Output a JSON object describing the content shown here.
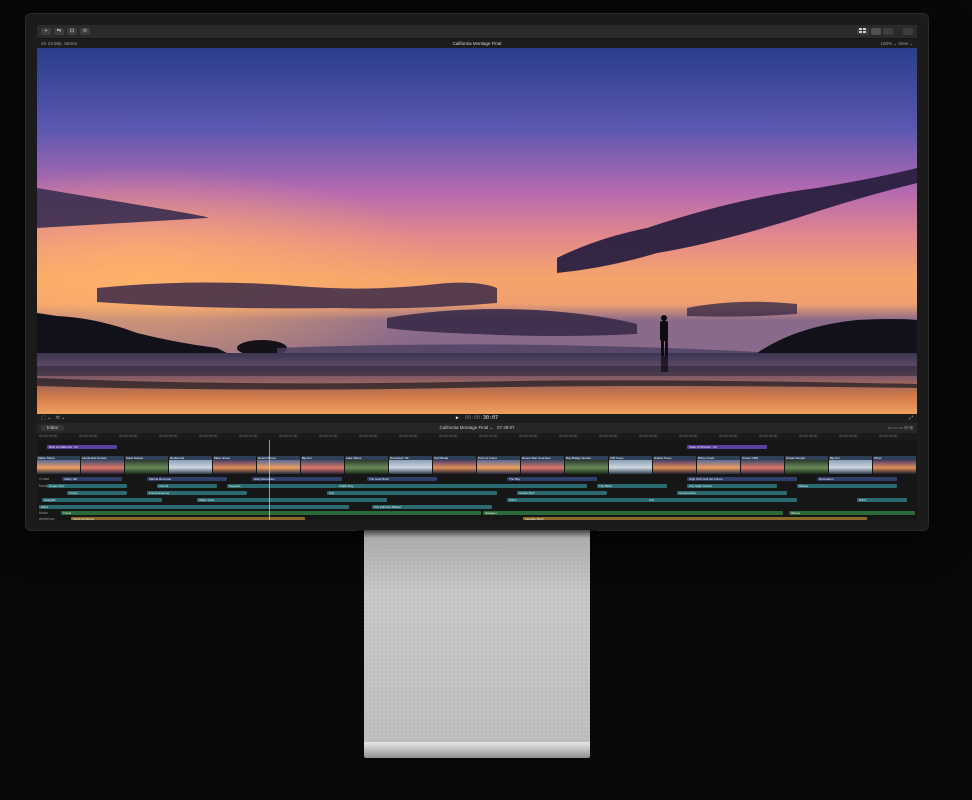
{
  "window": {
    "title": "California Montage Final",
    "toolbar_left": [
      "+",
      "⇆",
      "⊡",
      "⊙"
    ],
    "toolbar_right_icons": [
      "grid-icon",
      "list-icon",
      "inspector-icon",
      "share-icon"
    ]
  },
  "viewer": {
    "format": "4K 23.98p, Stereo",
    "zoom": "100%",
    "view_menu": "View",
    "timecode": "30:07"
  },
  "timeline": {
    "index_label": "Index",
    "project": "California Montage Final",
    "duration": "07:48:07",
    "ruler": [
      "00:00:00:00",
      "00:00:02:00",
      "00:00:04:00",
      "00:00:06:00",
      "00:00:08:00",
      "00:00:10:00",
      "00:00:12:00",
      "00:00:14:00",
      "00:00:16:00",
      "00:00:18:00",
      "00:00:20:00",
      "00:00:22:00",
      "00:00:24:00",
      "00:00:26:00",
      "00:00:28:00",
      "00:00:30:00",
      "00:00:32:00",
      "00:00:34:00",
      "00:00:36:00",
      "00:00:38:00",
      "00:00:40:00",
      "00:00:42:00"
    ],
    "title_clips": [
      {
        "label": "Best of California - 02"
      },
      {
        "label": "State of Wonder - 03"
      }
    ],
    "video_clips": [
      "Valley Shore",
      "Lands End Sunset",
      "Sand Sunset",
      "Redwoods",
      "Misty Grove",
      "Desert Bloom",
      "Big Sur",
      "Lake Tahoe",
      "Downtown SF",
      "Surf Break",
      "Point of Arena",
      "Desert Star Overview",
      "Bay Bridge Sunset",
      "Cliff Trees",
      "Hollow Trees",
      "Bixby Creek",
      "Ocean Cliffs",
      "Ocean Sunset",
      "Big Sur",
      "Pines"
    ],
    "lanes": {
      "lane1": {
        "label": "Crowd",
        "clips": [
          "Valley Hill",
          "Marina Reversal",
          "Early Evocation",
          "The Gold Rush",
          "The Bay",
          "High Tech and the Future",
          "Recreation"
        ]
      },
      "lane2": {
        "label": "Music",
        "clips": [
          "Ocean Surf",
          "Arts 01",
          "Seagulls",
          "Traffic Day",
          "The Birds",
          "City Night Crowd",
          "Waves"
        ]
      },
      "lane3": {
        "label": "",
        "clips": [
          "Crows",
          "Forest Evening",
          "City",
          "Ocean Surf",
          "Construction"
        ]
      },
      "lane4": {
        "label": "",
        "clips": [
          "Seagulls",
          "Water Loss",
          "Wind",
          "City",
          "Wind"
        ]
      },
      "lane5": {
        "label": "",
        "clips": [
          "Wind",
          "City Farmers Market"
        ]
      },
      "music": {
        "label": "Music",
        "clips": [
          "Travel",
          "Swapper",
          "Waves"
        ]
      },
      "ambient": {
        "label": "Ambience",
        "clips": [
          "Sand Ambience",
          "Seaside Spirit"
        ]
      }
    }
  }
}
